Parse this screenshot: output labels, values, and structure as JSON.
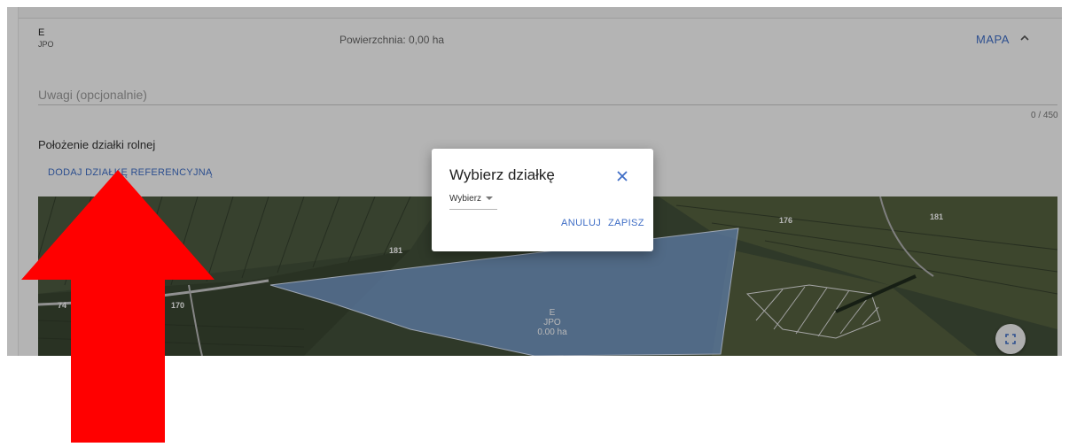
{
  "parcel": {
    "code": "E",
    "type": "JPO",
    "area_text": "Powierzchnia: 0,00 ha",
    "map_button": "MAPA"
  },
  "notes": {
    "placeholder": "Uwagi (opcjonalnie)",
    "counter": "0 / 450"
  },
  "location": {
    "title": "Położenie działki rolnej",
    "add_reference_parcel": "DODAJ DZIAŁKĘ REFERENCYJNĄ"
  },
  "map": {
    "parcel_labels": [
      "74",
      "170",
      "181",
      "176",
      "181"
    ],
    "selected_parcel": {
      "code": "E",
      "type": "JPO",
      "area": "0.00 ha"
    },
    "fill_color": "#7fa6df",
    "fullscreen_icon": "fullscreen-icon"
  },
  "dialog": {
    "title": "Wybierz działkę",
    "select_value": "Wybierz",
    "cancel": "ANULUJ",
    "save": "ZAPISZ"
  },
  "colors": {
    "accent": "#3f6ec6",
    "arrow": "#ff0000"
  }
}
